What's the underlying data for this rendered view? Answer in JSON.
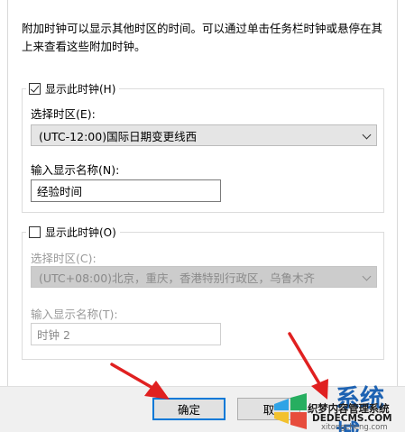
{
  "description": "附加时钟可以显示其他时区的时间。可以通过单击任务栏时钟或悬停在其上来查看这些附加时钟。",
  "clock1": {
    "checkbox_label": "显示此时钟(H)",
    "checked": true,
    "timezone_label": "选择时区(E):",
    "timezone_value": "(UTC-12:00)国际日期变更线西",
    "name_label": "输入显示名称(N):",
    "name_value": "经验时间"
  },
  "clock2": {
    "checkbox_label": "显示此时钟(O)",
    "checked": false,
    "timezone_label": "选择时区(C):",
    "timezone_value": "(UTC+08:00)北京，重庆，香港特别行政区，乌鲁木齐",
    "name_label": "输入显示名称(T):",
    "name_value": "时钟 2"
  },
  "buttons": {
    "ok": "确定",
    "cancel": "取"
  },
  "watermark": {
    "site": "系统城",
    "cn": "织梦内容管理系统",
    "en": "DEDECMS.COM",
    "url": "xitongcheng.com"
  },
  "colors": {
    "accent": "#0078d7",
    "arrow": "#e02020",
    "watermark_blue": "#1d62b2"
  }
}
